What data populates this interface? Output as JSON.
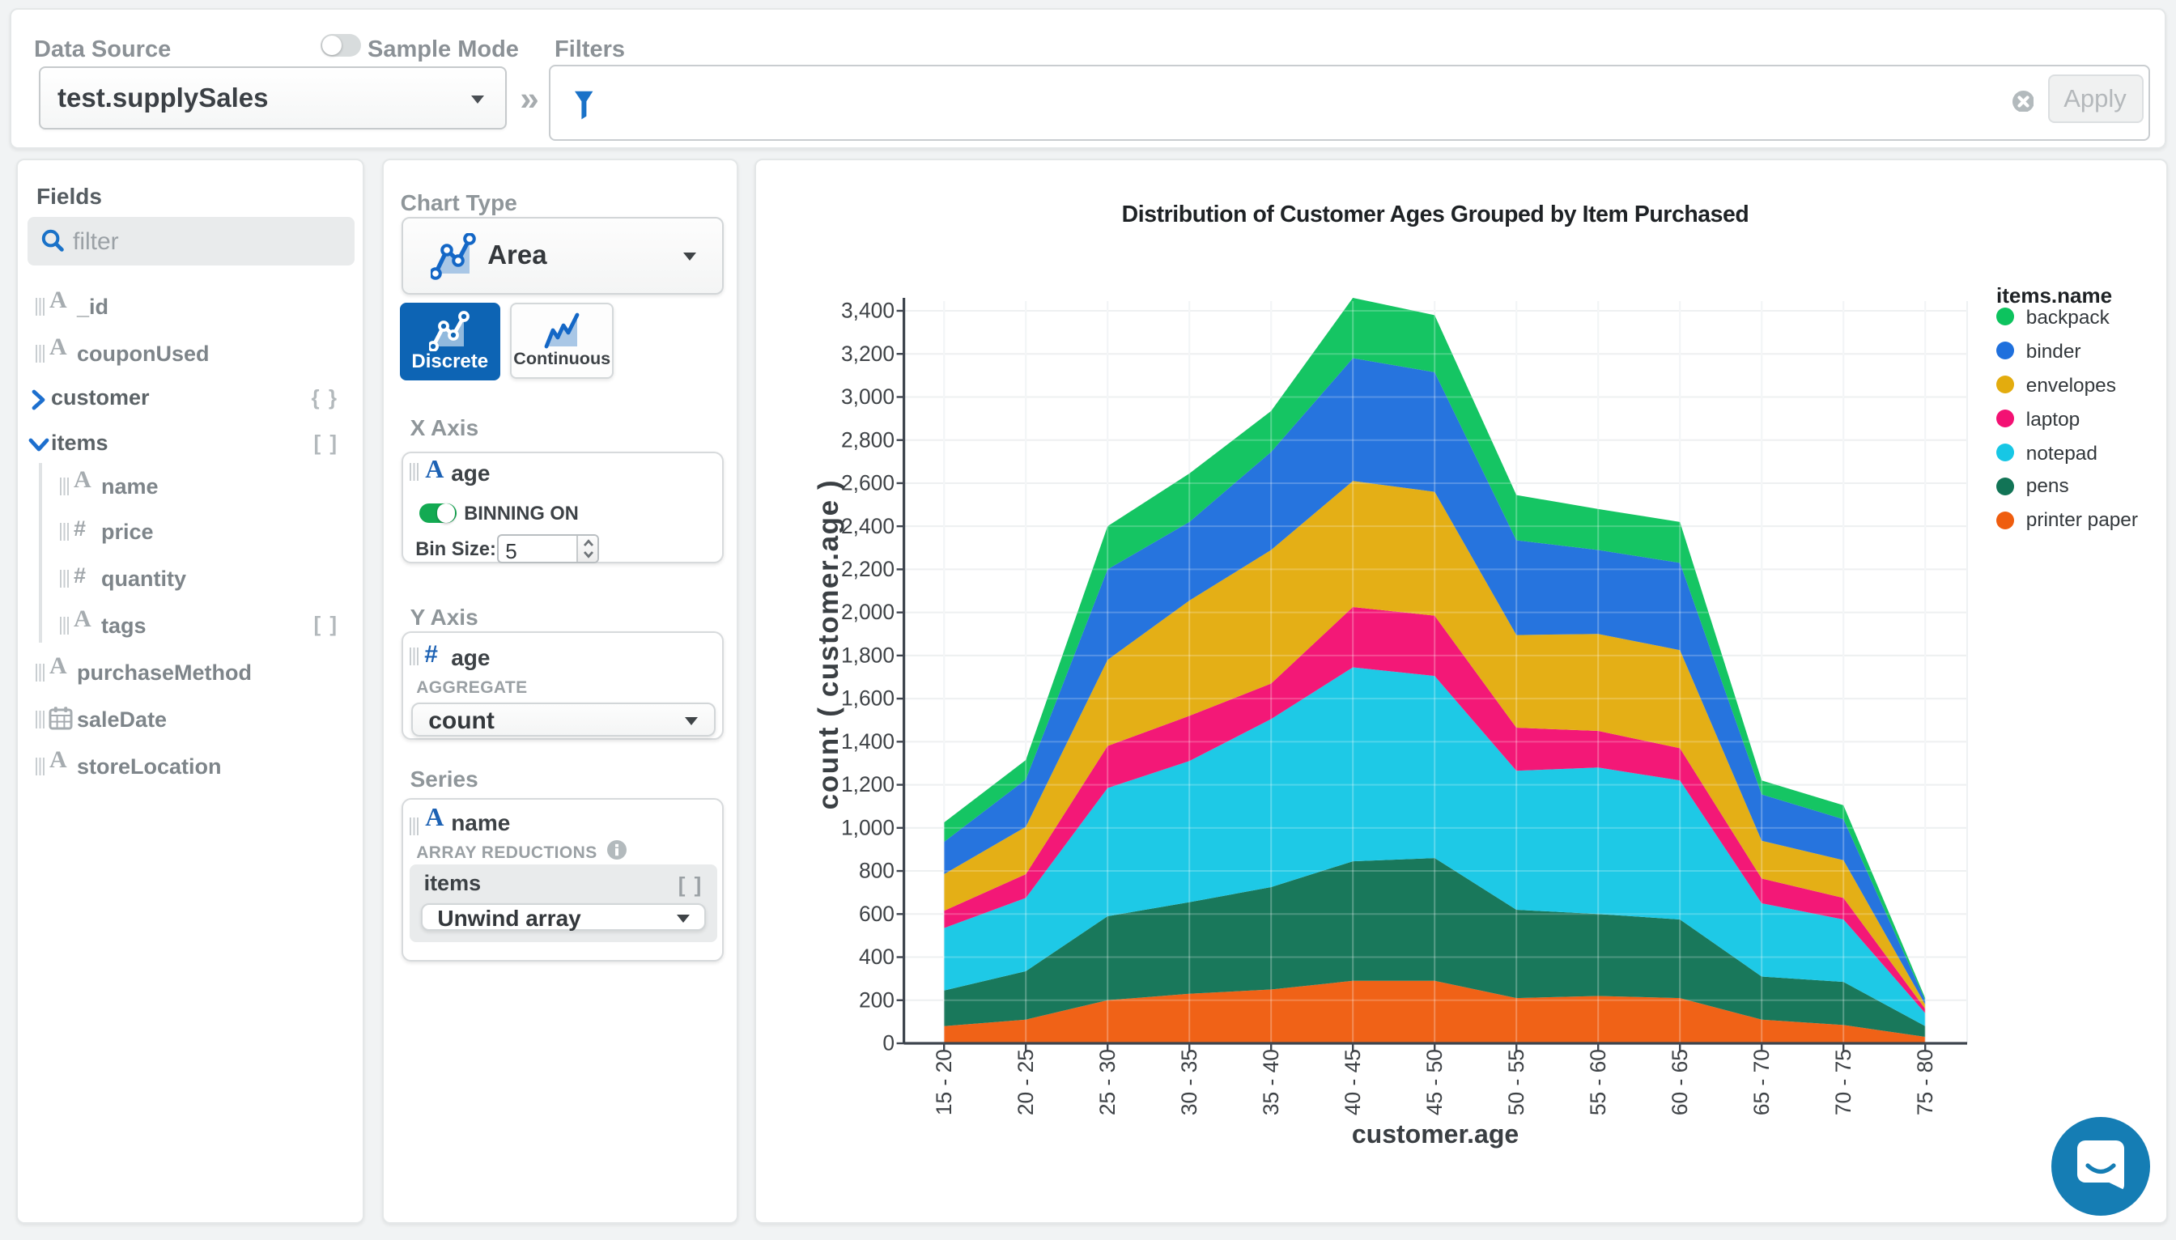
{
  "topbar": {
    "data_source_label": "Data Source",
    "data_source_value": "test.supplySales",
    "sample_mode_label": "Sample Mode",
    "filters_label": "Filters",
    "expander_glyph": "»",
    "apply_label": "Apply"
  },
  "fields_panel": {
    "title": "Fields",
    "search_placeholder": "filter",
    "items": [
      {
        "name": "_id",
        "type": "string"
      },
      {
        "name": "couponUsed",
        "type": "string"
      },
      {
        "name": "customer",
        "type": "object",
        "badge": "{ }",
        "parent": true,
        "state": "collapsed"
      },
      {
        "name": "items",
        "type": "array",
        "badge": "[ ]",
        "parent": true,
        "state": "expanded"
      },
      {
        "name": "name",
        "type": "string",
        "child": true
      },
      {
        "name": "price",
        "type": "number",
        "child": true
      },
      {
        "name": "quantity",
        "type": "number",
        "child": true
      },
      {
        "name": "tags",
        "type": "string",
        "child": true,
        "badge": "[ ]"
      },
      {
        "name": "purchaseMethod",
        "type": "string"
      },
      {
        "name": "saleDate",
        "type": "date"
      },
      {
        "name": "storeLocation",
        "type": "string"
      }
    ]
  },
  "config_panel": {
    "chart_type_label": "Chart Type",
    "chart_type_value": "Area",
    "discrete_label": "Discrete",
    "continuous_label": "Continuous",
    "x_axis": {
      "heading": "X Axis",
      "field": "age",
      "field_type": "string",
      "binning_label": "BINNING ON",
      "bin_size_label": "Bin Size:",
      "bin_size_value": "5"
    },
    "y_axis": {
      "heading": "Y Axis",
      "field": "age",
      "field_type": "number",
      "aggregate_label": "AGGREGATE",
      "aggregate_value": "count"
    },
    "series": {
      "heading": "Series",
      "field": "name",
      "field_type": "string",
      "array_reductions_label": "ARRAY REDUCTIONS",
      "array_field": "items",
      "array_badge": "[ ]",
      "reduction_value": "Unwind array"
    }
  },
  "chart_data": {
    "type": "area",
    "stacked": true,
    "title": "Distribution of Customer Ages Grouped by Item Purchased",
    "xlabel": "customer.age",
    "ylabel": "count ( customer.age )",
    "legend_title": "items.name",
    "legend_position": "right",
    "grid": true,
    "ylim": [
      0,
      3400
    ],
    "ytick_step": 200,
    "categories": [
      "15 - 20",
      "20 - 25",
      "25 - 30",
      "30 - 35",
      "35 - 40",
      "40 - 45",
      "45 - 50",
      "50 - 55",
      "55 - 60",
      "60 - 65",
      "65 - 70",
      "70 - 75",
      "75 - 80"
    ],
    "stack_order_bottom_to_top": [
      "printer paper",
      "pens",
      "notepad",
      "laptop",
      "envelopes",
      "binder",
      "backpack"
    ],
    "series": [
      {
        "name": "backpack",
        "color": "#0dc35e",
        "values": [
          90,
          90,
          200,
          225,
          190,
          280,
          265,
          210,
          190,
          190,
          65,
          65,
          10
        ]
      },
      {
        "name": "binder",
        "color": "#1f70dd",
        "values": [
          150,
          220,
          420,
          365,
          455,
          570,
          555,
          440,
          390,
          405,
          215,
          190,
          20
        ]
      },
      {
        "name": "envelopes",
        "color": "#e3ac0e",
        "values": [
          170,
          220,
          400,
          535,
          620,
          585,
          575,
          430,
          450,
          455,
          175,
          175,
          20
        ]
      },
      {
        "name": "laptop",
        "color": "#f31173",
        "values": [
          80,
          110,
          195,
          210,
          165,
          280,
          280,
          200,
          170,
          150,
          115,
          100,
          20
        ]
      },
      {
        "name": "notepad",
        "color": "#17c7e5",
        "values": [
          290,
          340,
          595,
          655,
          780,
          900,
          845,
          645,
          680,
          645,
          340,
          290,
          60
        ]
      },
      {
        "name": "pens",
        "color": "#127456",
        "values": [
          165,
          225,
          390,
          425,
          475,
          555,
          570,
          410,
          380,
          365,
          200,
          200,
          50
        ]
      },
      {
        "name": "printer paper",
        "color": "#ef5d0f",
        "values": [
          80,
          110,
          200,
          230,
          250,
          290,
          290,
          210,
          220,
          210,
          110,
          85,
          30
        ]
      }
    ]
  },
  "intercom": {
    "color": "#157db4"
  }
}
